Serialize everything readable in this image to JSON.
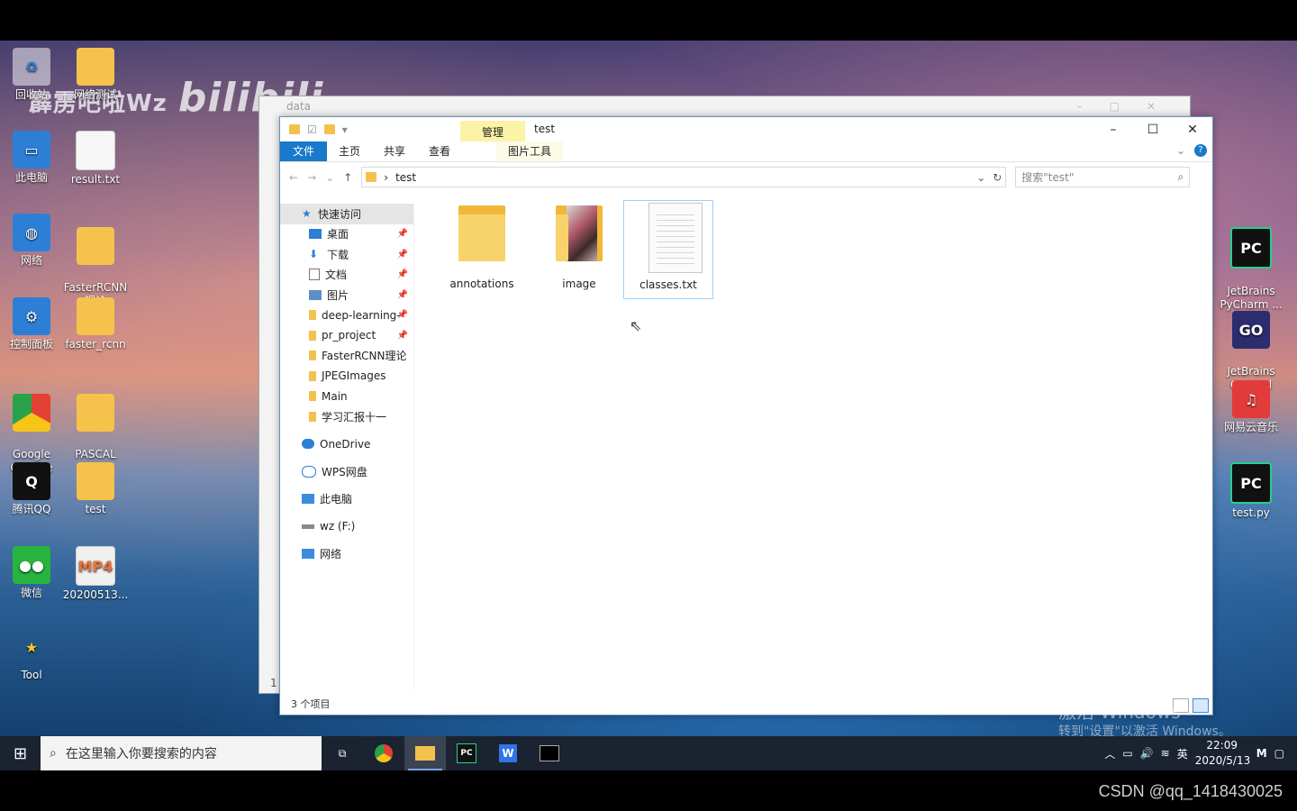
{
  "watermark": {
    "text": "霹雳吧啦Wz",
    "logo": "bilibili"
  },
  "csdn": "CSDN @qq_1418430025",
  "desktop_icons": {
    "recycle": "回收站",
    "folder_top": "网络测试",
    "this_pc": "此电脑",
    "result": "result.txt",
    "network": "网络",
    "fasterrcnn_theory": "FasterRCNN\n理论",
    "control_panel": "控制面板",
    "faster_rcnn": "faster_rcnn",
    "chrome": "Google\nChrome",
    "pascal": "PASCAL\nVOC",
    "qq": "腾讯QQ",
    "test": "test",
    "wechat": "微信",
    "mp4": "20200513...",
    "tool": "Tool",
    "pycharm": "JetBrains\nPyCharm ...",
    "goland": "JetBrains\nGoLand",
    "netease": "网易云音乐",
    "testpy": "test.py"
  },
  "back_window": {
    "title": "data",
    "status_number": "1"
  },
  "window": {
    "title": "test",
    "context_tab": "管理",
    "ribbon_tabs": {
      "file": "文件",
      "home": "主页",
      "share": "共享",
      "view": "查看",
      "picture_tools": "图片工具"
    },
    "address": {
      "crumb": "test"
    },
    "search": {
      "placeholder": "搜索\"test\""
    },
    "nav": {
      "quick_access": "快速访问",
      "desktop": "桌面",
      "downloads": "下载",
      "documents": "文档",
      "pictures": "图片",
      "deep_learning": "deep-learning-",
      "pr_project": "pr_project",
      "fasterrcnn": "FasterRCNN理论",
      "jpegimages": "JPEGImages",
      "main": "Main",
      "report": "学习汇报十一",
      "onedrive": "OneDrive",
      "wps": "WPS网盘",
      "thispc": "此电脑",
      "drive_f": "wz (F:)",
      "network": "网络"
    },
    "items": [
      "annotations",
      "image",
      "classes.txt"
    ],
    "status": "3 个项目"
  },
  "activate": {
    "line1": "激活 Windows",
    "line2": "转到\"设置\"以激活 Windows。"
  },
  "taskbar": {
    "search_placeholder": "在这里输入你要搜索的内容",
    "ime": "英",
    "time": "22:09",
    "date": "2020/5/13"
  }
}
